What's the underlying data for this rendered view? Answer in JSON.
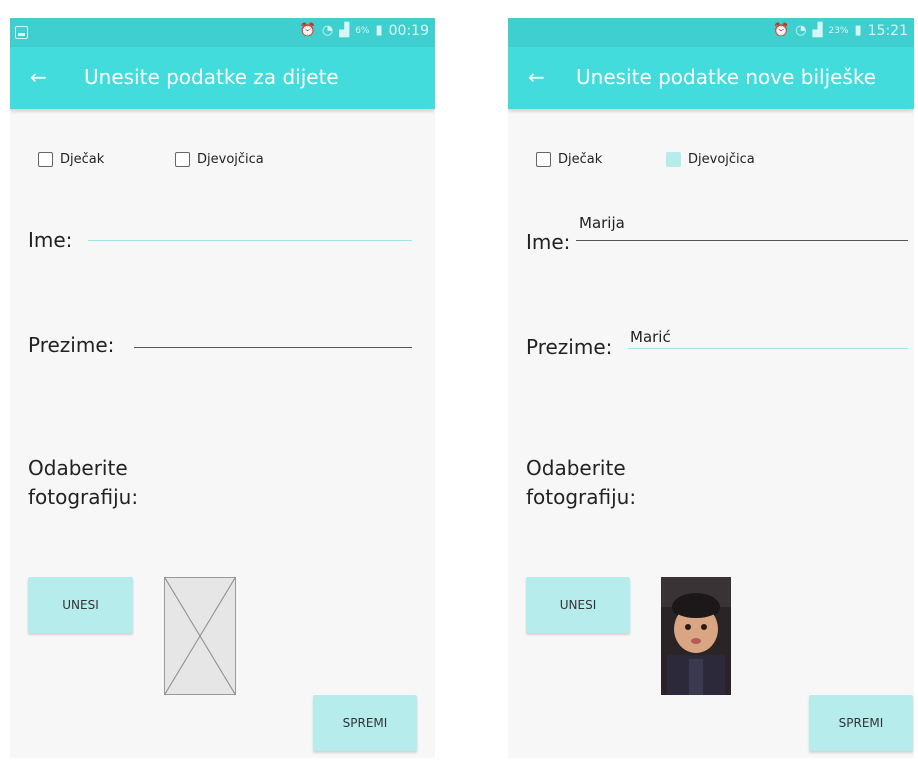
{
  "left_screen": {
    "status": {
      "battery_percent": "6%",
      "time": "00:19"
    },
    "appbar": {
      "back_icon": "back-arrow-icon",
      "title": "Unesite podatke za dijete"
    },
    "gender": {
      "boy_label": "Dječak",
      "boy_checked": false,
      "girl_label": "Djevojčica",
      "girl_checked": false
    },
    "first_name": {
      "label": "Ime:",
      "value": ""
    },
    "last_name": {
      "label": "Prezime:",
      "value": ""
    },
    "photo": {
      "label_line1": "Odaberite",
      "label_line2": "fotografiju:",
      "image": "placeholder-image"
    },
    "upload_button": "UNESI",
    "save_button": "SPREMI"
  },
  "right_screen": {
    "status": {
      "battery_percent": "23%",
      "time": "15:21"
    },
    "appbar": {
      "back_icon": "back-arrow-icon",
      "title": "Unesite podatke nove bilješke"
    },
    "gender": {
      "boy_label": "Dječak",
      "boy_checked": false,
      "girl_label": "Djevojčica",
      "girl_checked": true
    },
    "first_name": {
      "label": "Ime:",
      "value": "Marija"
    },
    "last_name": {
      "label": "Prezime:",
      "value": "Marić"
    },
    "photo": {
      "label_line1": "Odaberite",
      "label_line2": "fotografiju:",
      "image": "child-photo"
    },
    "upload_button": "UNESI",
    "save_button": "SPREMI"
  },
  "colors": {
    "status_bar": "#3fcfcf",
    "app_bar": "#43dcdc",
    "button": "#b6ecec",
    "screen_background": "#f7f7f7"
  }
}
